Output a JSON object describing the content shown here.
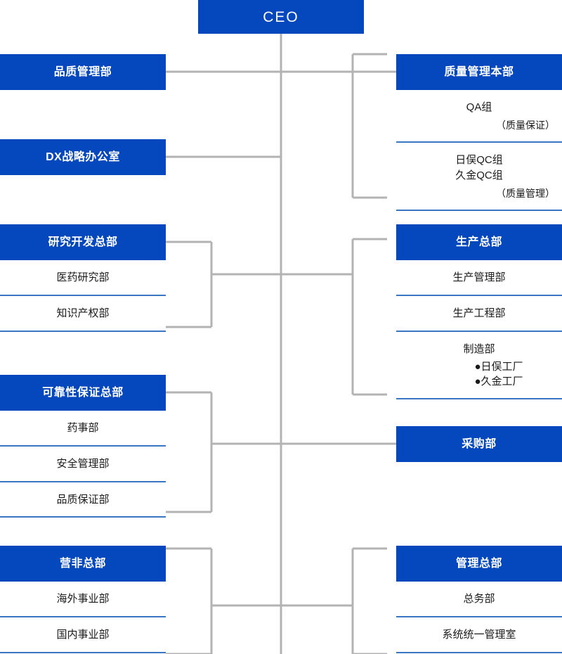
{
  "colors": {
    "header_blue": "#0548be",
    "divider_blue": "#3a76c4",
    "connector_gray": "#b3b3b3",
    "text_dark": "#1a1a1a",
    "text_white": "#ffffff"
  },
  "root": {
    "label": "CEO"
  },
  "left_column": [
    {
      "id": "quality-control-dept",
      "label": "品质管理部",
      "children": []
    },
    {
      "id": "dx-strategy-office",
      "label": "DX战略办公室",
      "children": []
    },
    {
      "id": "rd-headquarters",
      "label": "研究开发总部",
      "children": [
        {
          "title": "医药研究部"
        },
        {
          "title": "知识产权部"
        }
      ]
    },
    {
      "id": "reliability-assurance-hq",
      "label": "可靠性保证总部",
      "children": [
        {
          "title": "药事部"
        },
        {
          "title": "安全管理部"
        },
        {
          "title": "品质保证部"
        }
      ]
    },
    {
      "id": "sales-nonprofit-hq",
      "label": "营非总部",
      "children": [
        {
          "title": "海外事业部"
        },
        {
          "title": "国内事业部"
        }
      ]
    }
  ],
  "right_column": [
    {
      "id": "quality-management-hq",
      "label": "质量管理本部",
      "children": [
        {
          "title": "QA组",
          "note": "（质量保证）"
        },
        {
          "lines": [
            "日俣QC组",
            "久金QC组"
          ],
          "note": "（质量管理）"
        }
      ]
    },
    {
      "id": "production-hq",
      "label": "生产总部",
      "children": [
        {
          "title": "生产管理部"
        },
        {
          "title": "生产工程部"
        },
        {
          "title": "制造部",
          "bullets": [
            "日俣工厂",
            "久金工厂"
          ]
        }
      ]
    },
    {
      "id": "procurement-dept",
      "label": "采购部",
      "children": []
    },
    {
      "id": "administration-hq",
      "label": "管理总部",
      "children": [
        {
          "title": "总务部"
        },
        {
          "title": "系统统一管理室"
        }
      ]
    }
  ],
  "icons": {
    "bullet": "●"
  }
}
